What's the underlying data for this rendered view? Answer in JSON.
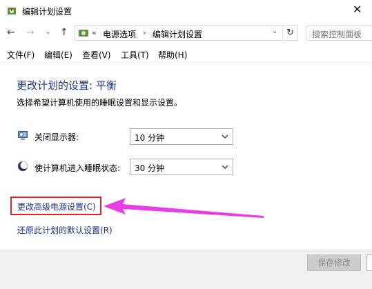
{
  "window": {
    "title": "编辑计划设置",
    "close_glyph": "✕"
  },
  "nav": {
    "back_glyph": "←",
    "forward_glyph": "→",
    "history_glyph": "⌄",
    "up_glyph": "↑",
    "address": {
      "prefix": "«",
      "crumbs": [
        "电源选项",
        "编辑计划设置"
      ],
      "separator": "›",
      "dropdown_glyph": "⌄"
    },
    "refresh_glyph": "↻",
    "search_placeholder": "搜索控制面板"
  },
  "menu": [
    "文件(F)",
    "编辑(E)",
    "查看(V)",
    "工具(T)",
    "帮助(H)"
  ],
  "main": {
    "heading": "更改计划的设置: 平衡",
    "subtext": "选择希望计算机使用的睡眠设置和显示设置。",
    "settings": [
      {
        "label": "关闭显示器:",
        "value": "10 分钟",
        "icon": "monitor-icon"
      },
      {
        "label": "使计算机进入睡眠状态:",
        "value": "30 分钟",
        "icon": "sleep-moon-icon"
      }
    ],
    "links": [
      "更改高级电源设置(C)",
      "还原此计划的默认设置(R)"
    ]
  },
  "footer": {
    "save_label": "保存修改"
  },
  "colors": {
    "link": "#1e3287",
    "annotation": "#ee1c25",
    "arrow": "#e83ee8"
  }
}
